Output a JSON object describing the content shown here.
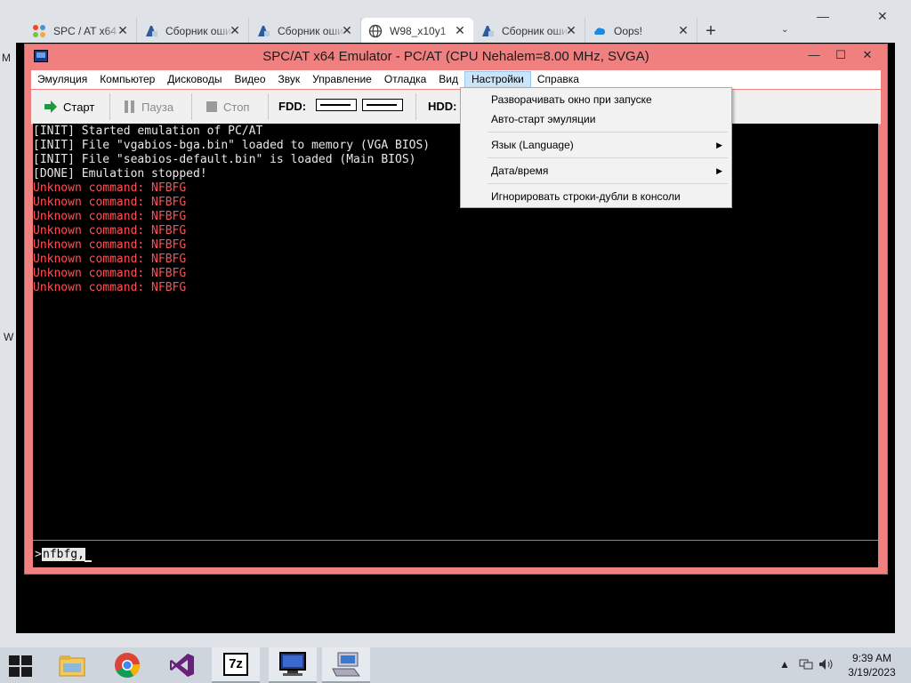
{
  "browser": {
    "tabs": [
      {
        "title": "SPC / AT x64",
        "icon": "joomla-icon",
        "active": false
      },
      {
        "title": "Сборник ошибок",
        "icon": "doc-icon",
        "active": false
      },
      {
        "title": "Сборник ошибок",
        "icon": "doc-icon",
        "active": false
      },
      {
        "title": "W98_x10y1",
        "icon": "globe-icon",
        "active": true
      },
      {
        "title": "Сборник ошибок",
        "icon": "doc-icon",
        "active": false
      },
      {
        "title": "Oops!",
        "icon": "cloud-icon",
        "active": false
      }
    ],
    "new_tab": "+",
    "tab_menu": "⌄",
    "minimize": "—",
    "close": "✕",
    "side_letters": [
      "M",
      "W"
    ]
  },
  "emulator": {
    "title": "SPC/AT x64 Emulator - PC/AT (CPU Nehalem=8.00 MHz, SVGA)",
    "minimize": "—",
    "maximize": "☐",
    "close": "✕",
    "menu": [
      "Эмуляция",
      "Компьютер",
      "Дисководы",
      "Видео",
      "Звук",
      "Управление",
      "Отладка",
      "Вид",
      "Настройки",
      "Справка"
    ],
    "toolbar": {
      "start": "Старт",
      "pause": "Пауза",
      "stop": "Стоп",
      "fdd": "FDD:",
      "hdd": "HDD:"
    },
    "console_lines": [
      {
        "text": "[INIT] Started emulation of PC/AT",
        "kind": "white"
      },
      {
        "text": "[INIT] File \"vgabios-bga.bin\" loaded to memory (VGA BIOS)",
        "kind": "white"
      },
      {
        "text": "[INIT] File \"seabios-default.bin\" is loaded (Main BIOS)",
        "kind": "white"
      },
      {
        "text": "[DONE] Emulation stopped!",
        "kind": "white"
      },
      {
        "text": "Unknown command: NFBFG",
        "kind": "red"
      },
      {
        "text": "Unknown command: NFBFG",
        "kind": "red"
      },
      {
        "text": "Unknown command: NFBFG",
        "kind": "red"
      },
      {
        "text": "Unknown command: NFBFG",
        "kind": "red"
      },
      {
        "text": "Unknown command: NFBFG",
        "kind": "red"
      },
      {
        "text": "Unknown command: NFBFG",
        "kind": "red"
      },
      {
        "text": "Unknown command: NFBFG",
        "kind": "red"
      },
      {
        "text": "Unknown command: NFBFG",
        "kind": "red"
      }
    ],
    "prompt": ">",
    "input_value": "nfbfg,"
  },
  "settings_menu": [
    {
      "label": "Разворачивать окно при запуске",
      "submenu": false
    },
    {
      "label": "Авто-старт эмуляции",
      "submenu": false
    },
    {
      "label": "Язык (Language)",
      "submenu": true
    },
    {
      "label": "Дата/время",
      "submenu": true
    },
    {
      "label": "Игнорировать строки-дубли в консоли",
      "submenu": false
    }
  ],
  "submenu_arrow": "▶",
  "taskbar": {
    "apps": [
      "file-explorer-icon",
      "chrome-icon",
      "visual-studio-icon",
      "7zip-icon",
      "monitor-icon",
      "keyboard-computer-icon"
    ],
    "sevenzip_label": "7z",
    "time": "9:39 AM",
    "date": "3/19/2023",
    "tray_up": "▲"
  },
  "colors": {
    "emulator_frame": "#f08080",
    "console_text": "#e8e8e8",
    "error_text": "#ff5050",
    "menu_highlight": "#cce4f7"
  }
}
